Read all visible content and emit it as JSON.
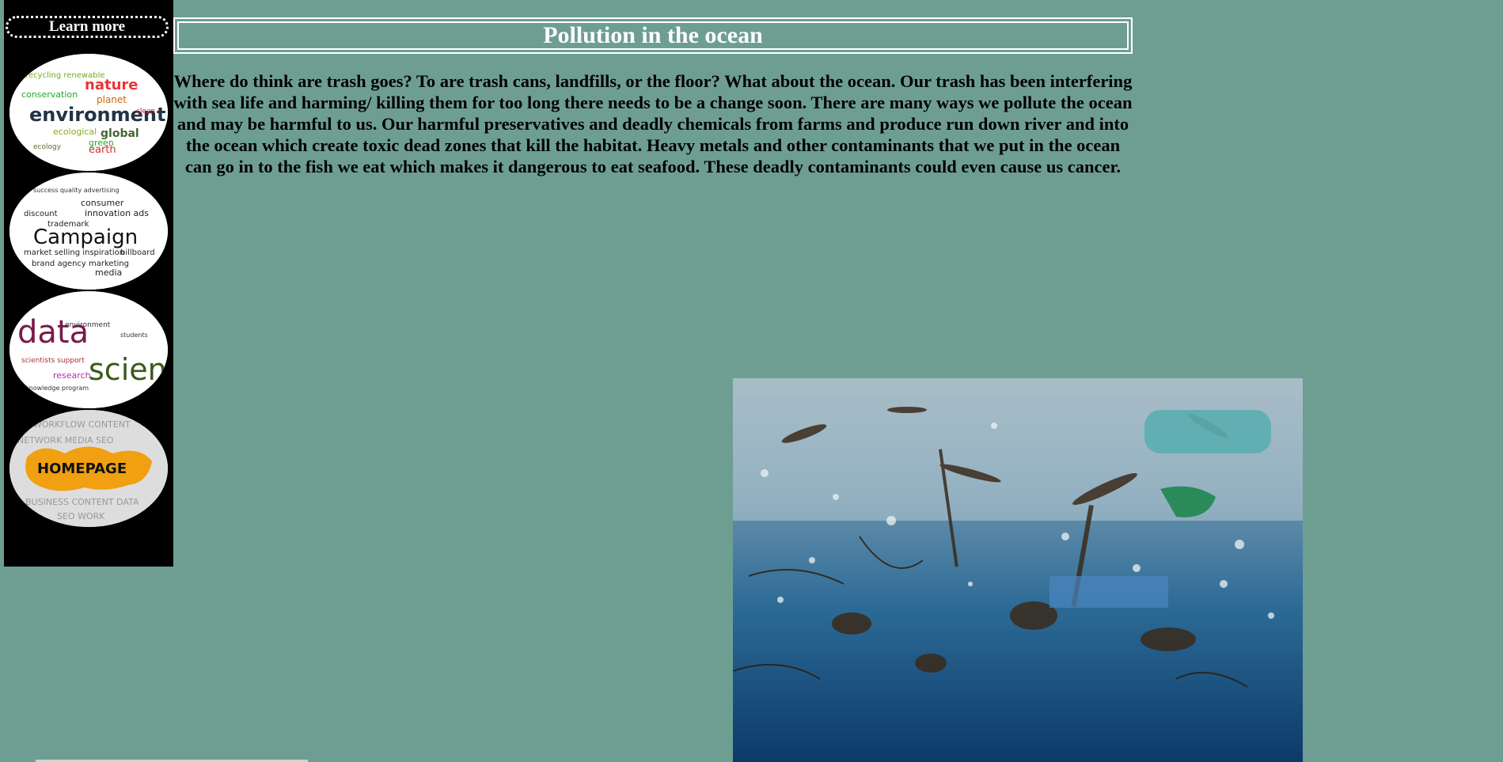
{
  "sidebar": {
    "learn_more_label": "Learn more",
    "nav_items": [
      {
        "name": "environment",
        "label": "environment"
      },
      {
        "name": "campaign",
        "label": "Campaign"
      },
      {
        "name": "data-science",
        "label_a": "data",
        "label_b": "science"
      },
      {
        "name": "homepage",
        "label": "HOMEPAGE"
      }
    ]
  },
  "main": {
    "title": "Pollution in the ocean",
    "paragraph": "Where do think are trash goes? To are trash cans, landfills, or the floor? What about the ocean. Our trash has been interfering with sea life and harming/ killing them for too long there needs to be a change soon. There are many ways we pollute the ocean and may be harmful to us. Our harmful preservatives and deadly chemicals from farms and produce run down river and into the ocean which create toxic dead zones that kill the habitat. Heavy metals and other contaminants that we put in the ocean can go in to the fish we eat which makes it dangerous to eat seafood. These deadly contaminants could even cause us cancer."
  },
  "colors": {
    "page_background": "#6e9e92",
    "sidebar_background": "#000000",
    "title_text": "#ffffff"
  }
}
